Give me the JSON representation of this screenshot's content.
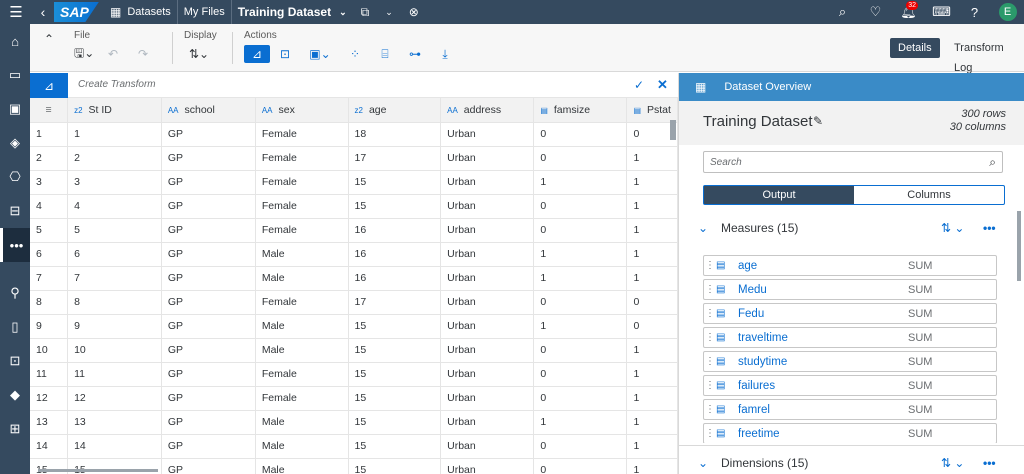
{
  "shell": {
    "logo": "SAP",
    "breadcrumbs": [
      "Datasets",
      "My Files"
    ],
    "dataset_title": "Training Dataset",
    "notification_count": "32",
    "user_initial": "E"
  },
  "toolbar": {
    "file_label": "File",
    "display_label": "Display",
    "actions_label": "Actions",
    "details_label": "Details",
    "transform_log_label": "Transform Log"
  },
  "transform": {
    "placeholder": "Create Transform"
  },
  "grid": {
    "columns": [
      {
        "type": "z2",
        "name": "St ID"
      },
      {
        "type": "AA",
        "name": "school"
      },
      {
        "type": "AA",
        "name": "sex"
      },
      {
        "type": "z2",
        "name": "age"
      },
      {
        "type": "AA",
        "name": "address"
      },
      {
        "type": "▤",
        "name": "famsize"
      },
      {
        "type": "▤",
        "name": "Pstat"
      }
    ],
    "rows": [
      [
        "1",
        "1",
        "GP",
        "Female",
        "18",
        "Urban",
        "0",
        "0"
      ],
      [
        "2",
        "2",
        "GP",
        "Female",
        "17",
        "Urban",
        "0",
        "1"
      ],
      [
        "3",
        "3",
        "GP",
        "Female",
        "15",
        "Urban",
        "1",
        "1"
      ],
      [
        "4",
        "4",
        "GP",
        "Female",
        "15",
        "Urban",
        "0",
        "1"
      ],
      [
        "5",
        "5",
        "GP",
        "Female",
        "16",
        "Urban",
        "0",
        "1"
      ],
      [
        "6",
        "6",
        "GP",
        "Male",
        "16",
        "Urban",
        "1",
        "1"
      ],
      [
        "7",
        "7",
        "GP",
        "Male",
        "16",
        "Urban",
        "1",
        "1"
      ],
      [
        "8",
        "8",
        "GP",
        "Female",
        "17",
        "Urban",
        "0",
        "0"
      ],
      [
        "9",
        "9",
        "GP",
        "Male",
        "15",
        "Urban",
        "1",
        "0"
      ],
      [
        "10",
        "10",
        "GP",
        "Male",
        "15",
        "Urban",
        "0",
        "1"
      ],
      [
        "11",
        "11",
        "GP",
        "Female",
        "15",
        "Urban",
        "0",
        "1"
      ],
      [
        "12",
        "12",
        "GP",
        "Female",
        "15",
        "Urban",
        "0",
        "1"
      ],
      [
        "13",
        "13",
        "GP",
        "Male",
        "15",
        "Urban",
        "1",
        "1"
      ],
      [
        "14",
        "14",
        "GP",
        "Male",
        "15",
        "Urban",
        "0",
        "1"
      ],
      [
        "15",
        "15",
        "GP",
        "Male",
        "15",
        "Urban",
        "0",
        "1"
      ]
    ]
  },
  "panel": {
    "title": "Dataset Overview",
    "dataset_name": "Training Dataset",
    "rows": "300 rows",
    "columns": "30 columns",
    "search_placeholder": "Search",
    "seg_output": "Output",
    "seg_columns": "Columns",
    "measures_label": "Measures (15)",
    "dimensions_label": "Dimensions (15)",
    "measures": [
      {
        "name": "age",
        "agg": "SUM"
      },
      {
        "name": "Medu",
        "agg": "SUM"
      },
      {
        "name": "Fedu",
        "agg": "SUM"
      },
      {
        "name": "traveltime",
        "agg": "SUM"
      },
      {
        "name": "studytime",
        "agg": "SUM"
      },
      {
        "name": "failures",
        "agg": "SUM"
      },
      {
        "name": "famrel",
        "agg": "SUM"
      },
      {
        "name": "freetime",
        "agg": "SUM"
      }
    ]
  }
}
